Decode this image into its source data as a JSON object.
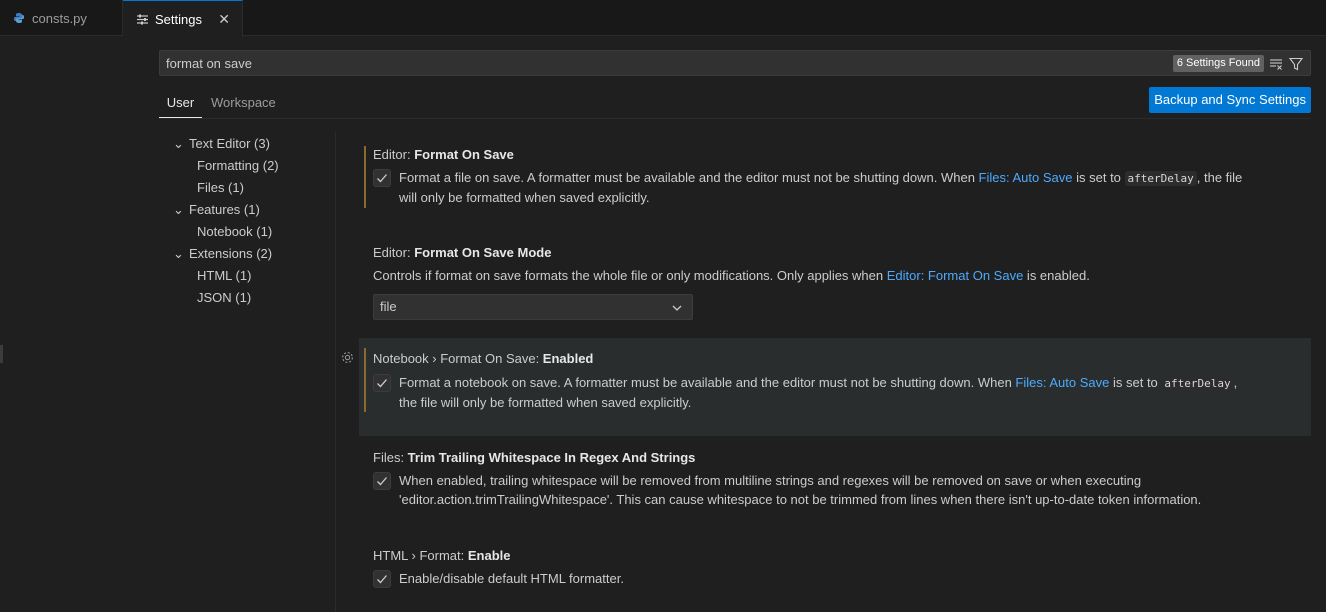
{
  "tabs": [
    {
      "label": "consts.py",
      "icon": "python-icon"
    },
    {
      "label": "Settings",
      "icon": "settings-sliders-icon",
      "close": "✕"
    }
  ],
  "search": {
    "value": "format on save",
    "results_badge": "6 Settings Found"
  },
  "scope_tabs": {
    "user": "User",
    "workspace": "Workspace"
  },
  "sync_button": "Backup and Sync Settings",
  "toc": [
    {
      "label": "Text Editor (3)",
      "level": 0
    },
    {
      "label": "Formatting (2)",
      "level": 1
    },
    {
      "label": "Files (1)",
      "level": 1
    },
    {
      "label": "Features (1)",
      "level": 0
    },
    {
      "label": "Notebook (1)",
      "level": 1
    },
    {
      "label": "Extensions (2)",
      "level": 0
    },
    {
      "label": "HTML (1)",
      "level": 1
    },
    {
      "label": "JSON (1)",
      "level": 1
    }
  ],
  "settings": {
    "s1": {
      "category": "Editor: ",
      "name": "Format On Save",
      "desc_a": "Format a file on save. A formatter must be available and the editor must not be shutting down. When ",
      "link": "Files: Auto Save",
      "desc_b": " is set to ",
      "code": "afterDelay",
      "desc_c": ", the file",
      "desc_d": "will only be formatted when saved explicitly.",
      "checked": true
    },
    "s2": {
      "category": "Editor: ",
      "name": "Format On Save Mode",
      "desc_a": "Controls if format on save formats the whole file or only modifications. Only applies when ",
      "link": "Editor: Format On Save",
      "desc_b": " is enabled.",
      "select_value": "file"
    },
    "s3": {
      "category": "Notebook › Format On Save: ",
      "name": "Enabled",
      "desc_a": "Format a notebook on save. A formatter must be available and the editor must not be shutting down. When ",
      "link": "Files: Auto Save",
      "desc_b": " is set to ",
      "code": "afterDelay",
      "desc_c": ",",
      "desc_d": "the file will only be formatted when saved explicitly.",
      "checked": true
    },
    "s4": {
      "category": "Files: ",
      "name": "Trim Trailing Whitespace In Regex And Strings",
      "desc_a": "When enabled, trailing whitespace will be removed from multiline strings and regexes will be removed on save or when executing",
      "desc_d": "'editor.action.trimTrailingWhitespace'. This can cause whitespace to not be trimmed from lines when there isn't up-to-date token information.",
      "checked": true
    },
    "s5": {
      "category": "HTML › Format: ",
      "name": "Enable",
      "desc_a": "Enable/disable default HTML formatter.",
      "checked": true
    }
  }
}
